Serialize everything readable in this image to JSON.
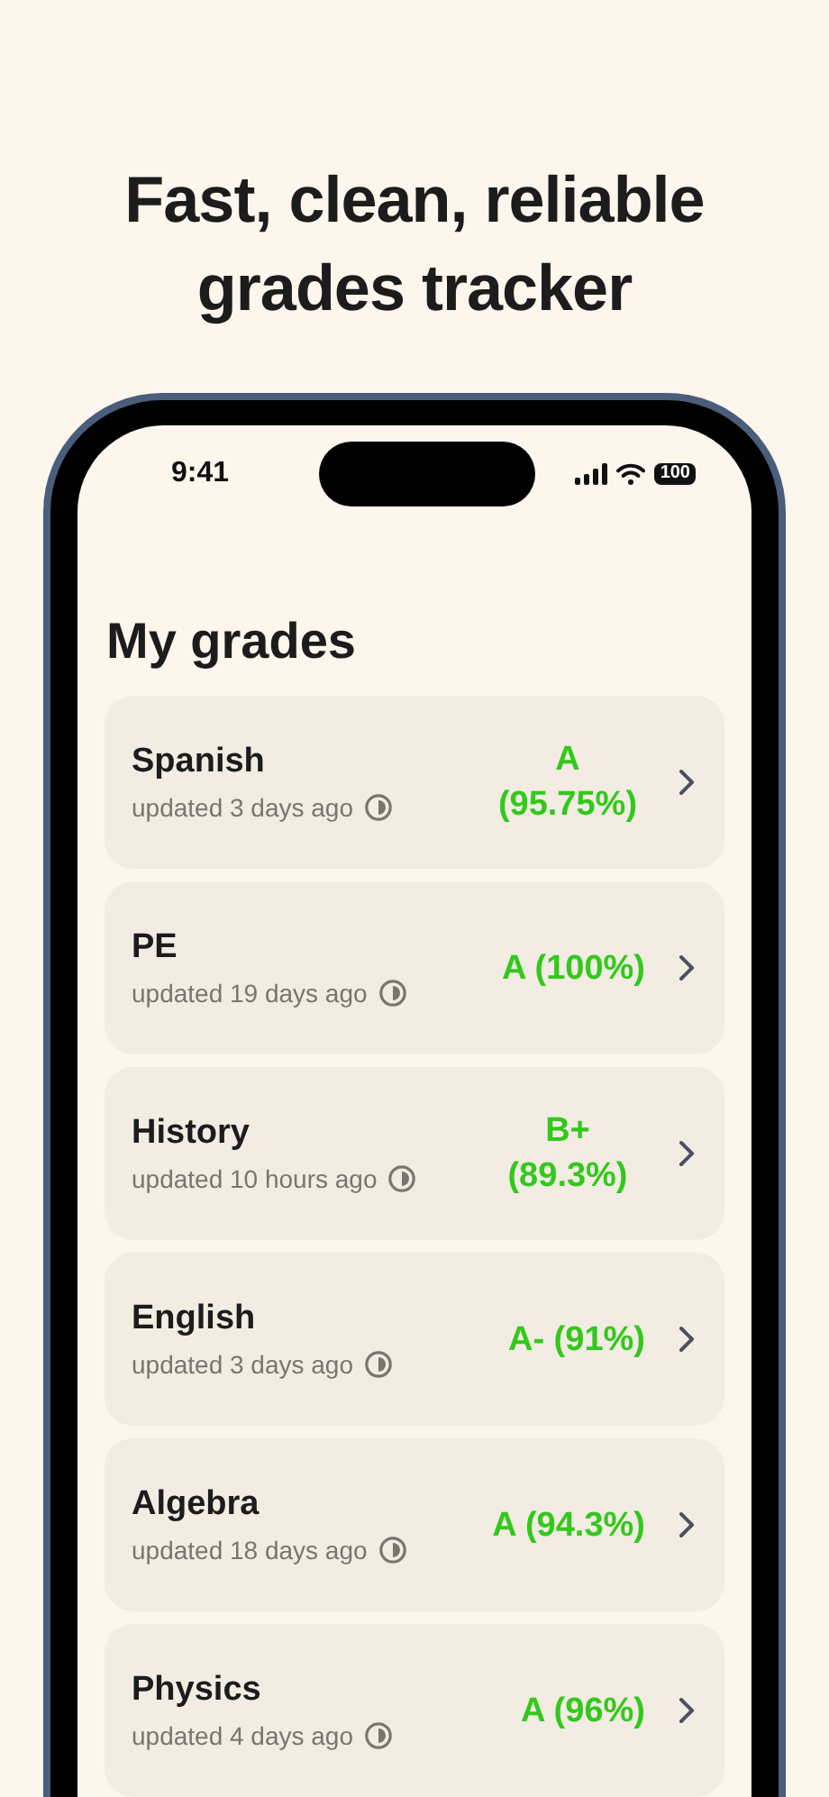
{
  "headline": "Fast, clean, reliable grades tracker",
  "status_bar": {
    "time": "9:41",
    "battery": "100"
  },
  "title": "My grades",
  "courses": [
    {
      "name": "Spanish",
      "updated": "updated 3 days ago",
      "grade": "A (95.75%)"
    },
    {
      "name": "PE",
      "updated": "updated 19 days ago",
      "grade": "A (100%)"
    },
    {
      "name": "History",
      "updated": "updated 10 hours ago",
      "grade": "B+ (89.3%)"
    },
    {
      "name": "English",
      "updated": "updated 3 days ago",
      "grade": "A- (91%)"
    },
    {
      "name": "Algebra",
      "updated": "updated 18 days ago",
      "grade": "A (94.3%)"
    },
    {
      "name": "Physics",
      "updated": "updated 4 days ago",
      "grade": "A (96%)"
    }
  ]
}
